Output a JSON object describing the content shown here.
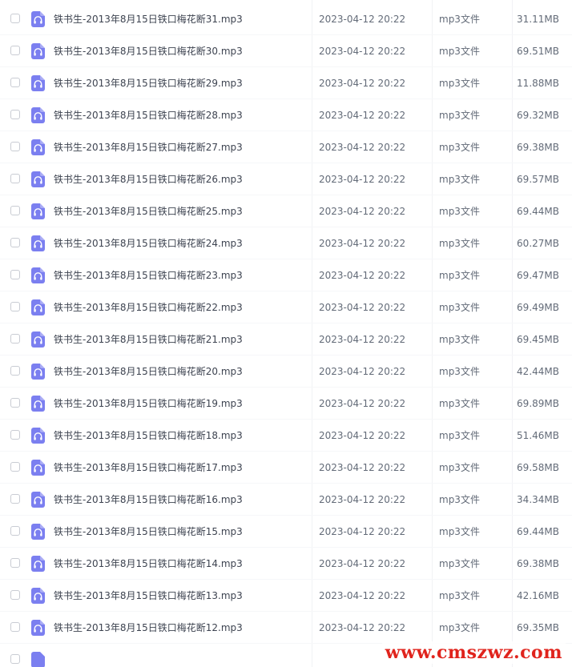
{
  "file_list": {
    "file_icon": "music-file-icon",
    "icon_color": "#7b7ff0",
    "rows": [
      {
        "name": "铁书生-2013年8月15日铁口梅花断31.mp3",
        "date": "2023-04-12 20:22",
        "type": "mp3文件",
        "size": "31.11MB"
      },
      {
        "name": "铁书生-2013年8月15日铁口梅花断30.mp3",
        "date": "2023-04-12 20:22",
        "type": "mp3文件",
        "size": "69.51MB"
      },
      {
        "name": "铁书生-2013年8月15日铁口梅花断29.mp3",
        "date": "2023-04-12 20:22",
        "type": "mp3文件",
        "size": "11.88MB"
      },
      {
        "name": "铁书生-2013年8月15日铁口梅花断28.mp3",
        "date": "2023-04-12 20:22",
        "type": "mp3文件",
        "size": "69.32MB"
      },
      {
        "name": "铁书生-2013年8月15日铁口梅花断27.mp3",
        "date": "2023-04-12 20:22",
        "type": "mp3文件",
        "size": "69.38MB"
      },
      {
        "name": "铁书生-2013年8月15日铁口梅花断26.mp3",
        "date": "2023-04-12 20:22",
        "type": "mp3文件",
        "size": "69.57MB"
      },
      {
        "name": "铁书生-2013年8月15日铁口梅花断25.mp3",
        "date": "2023-04-12 20:22",
        "type": "mp3文件",
        "size": "69.44MB"
      },
      {
        "name": "铁书生-2013年8月15日铁口梅花断24.mp3",
        "date": "2023-04-12 20:22",
        "type": "mp3文件",
        "size": "60.27MB"
      },
      {
        "name": "铁书生-2013年8月15日铁口梅花断23.mp3",
        "date": "2023-04-12 20:22",
        "type": "mp3文件",
        "size": "69.47MB"
      },
      {
        "name": "铁书生-2013年8月15日铁口梅花断22.mp3",
        "date": "2023-04-12 20:22",
        "type": "mp3文件",
        "size": "69.49MB"
      },
      {
        "name": "铁书生-2013年8月15日铁口梅花断21.mp3",
        "date": "2023-04-12 20:22",
        "type": "mp3文件",
        "size": "69.45MB"
      },
      {
        "name": "铁书生-2013年8月15日铁口梅花断20.mp3",
        "date": "2023-04-12 20:22",
        "type": "mp3文件",
        "size": "42.44MB"
      },
      {
        "name": "铁书生-2013年8月15日铁口梅花断19.mp3",
        "date": "2023-04-12 20:22",
        "type": "mp3文件",
        "size": "69.89MB"
      },
      {
        "name": "铁书生-2013年8月15日铁口梅花断18.mp3",
        "date": "2023-04-12 20:22",
        "type": "mp3文件",
        "size": "51.46MB"
      },
      {
        "name": "铁书生-2013年8月15日铁口梅花断17.mp3",
        "date": "2023-04-12 20:22",
        "type": "mp3文件",
        "size": "69.58MB"
      },
      {
        "name": "铁书生-2013年8月15日铁口梅花断16.mp3",
        "date": "2023-04-12 20:22",
        "type": "mp3文件",
        "size": "34.34MB"
      },
      {
        "name": "铁书生-2013年8月15日铁口梅花断15.mp3",
        "date": "2023-04-12 20:22",
        "type": "mp3文件",
        "size": "69.44MB"
      },
      {
        "name": "铁书生-2013年8月15日铁口梅花断14.mp3",
        "date": "2023-04-12 20:22",
        "type": "mp3文件",
        "size": "69.38MB"
      },
      {
        "name": "铁书生-2013年8月15日铁口梅花断13.mp3",
        "date": "2023-04-12 20:22",
        "type": "mp3文件",
        "size": "42.16MB"
      },
      {
        "name": "铁书生-2013年8月15日铁口梅花断12.mp3",
        "date": "2023-04-12 20:22",
        "type": "mp3文件",
        "size": "69.35MB"
      }
    ]
  },
  "watermark": {
    "text": "www.cmszwz.com",
    "color": "#e0241d"
  }
}
